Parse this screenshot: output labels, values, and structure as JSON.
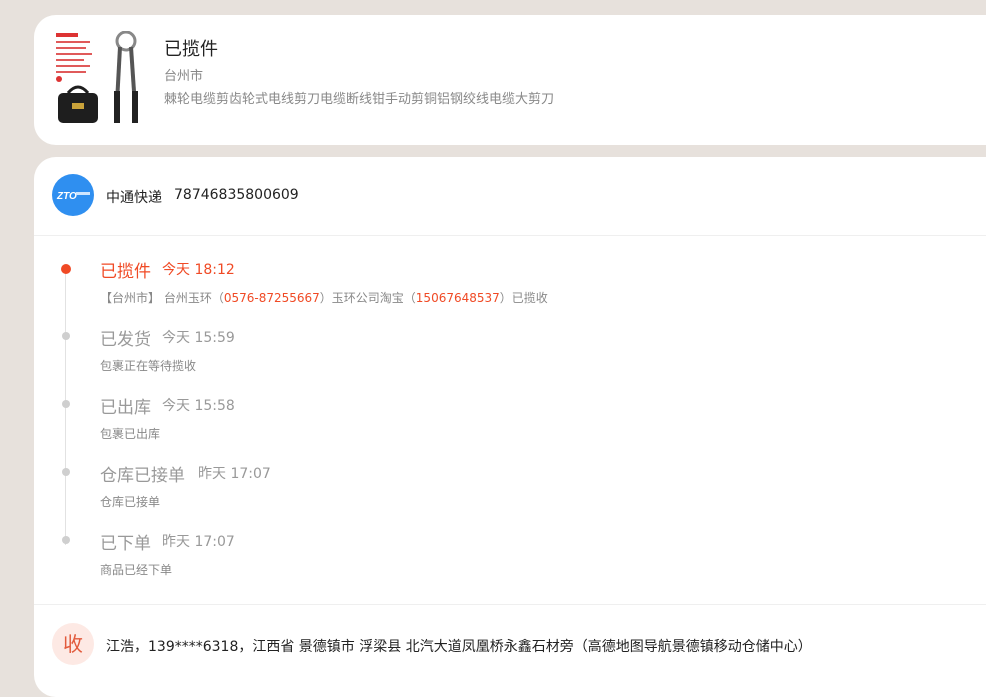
{
  "product": {
    "status": "已揽件",
    "city": "台州市",
    "title": "棘轮电缆剪齿轮式电线剪刀电缆断线钳手动剪铜铝钢绞线电缆大剪刀"
  },
  "carrier": {
    "logo_text": "ZTO 中通快递",
    "name": "中通快递",
    "tracking_number": "78746835800609"
  },
  "timeline": [
    {
      "status": "已揽件",
      "time": "今天 18:12",
      "active": true,
      "desc_parts": {
        "a": "【台州市】 台州玉环（",
        "phone1": "0576-87255667",
        "b": "）玉环公司淘宝（",
        "phone2": "15067648537",
        "c": "）已揽收"
      }
    },
    {
      "status": "已发货",
      "time": "今天 15:59",
      "desc": "包裹正在等待揽收"
    },
    {
      "status": "已出库",
      "time": "今天 15:58",
      "desc": "包裹已出库"
    },
    {
      "status": "仓库已接单",
      "time": "昨天 17:07",
      "desc": "仓库已接单"
    },
    {
      "status": "已下单",
      "time": "昨天 17:07",
      "desc": "商品已经下单"
    }
  ],
  "recipient": {
    "icon_label": "收",
    "text": "江浩，139****6318，江西省 景德镇市 浮梁县 北汽大道凤凰桥永鑫石材旁（高德地图导航景德镇移动仓储中心）"
  },
  "colors": {
    "accent": "#f04a25",
    "carrier_blue": "#2f8ff0",
    "background": "#e7e1dc"
  }
}
